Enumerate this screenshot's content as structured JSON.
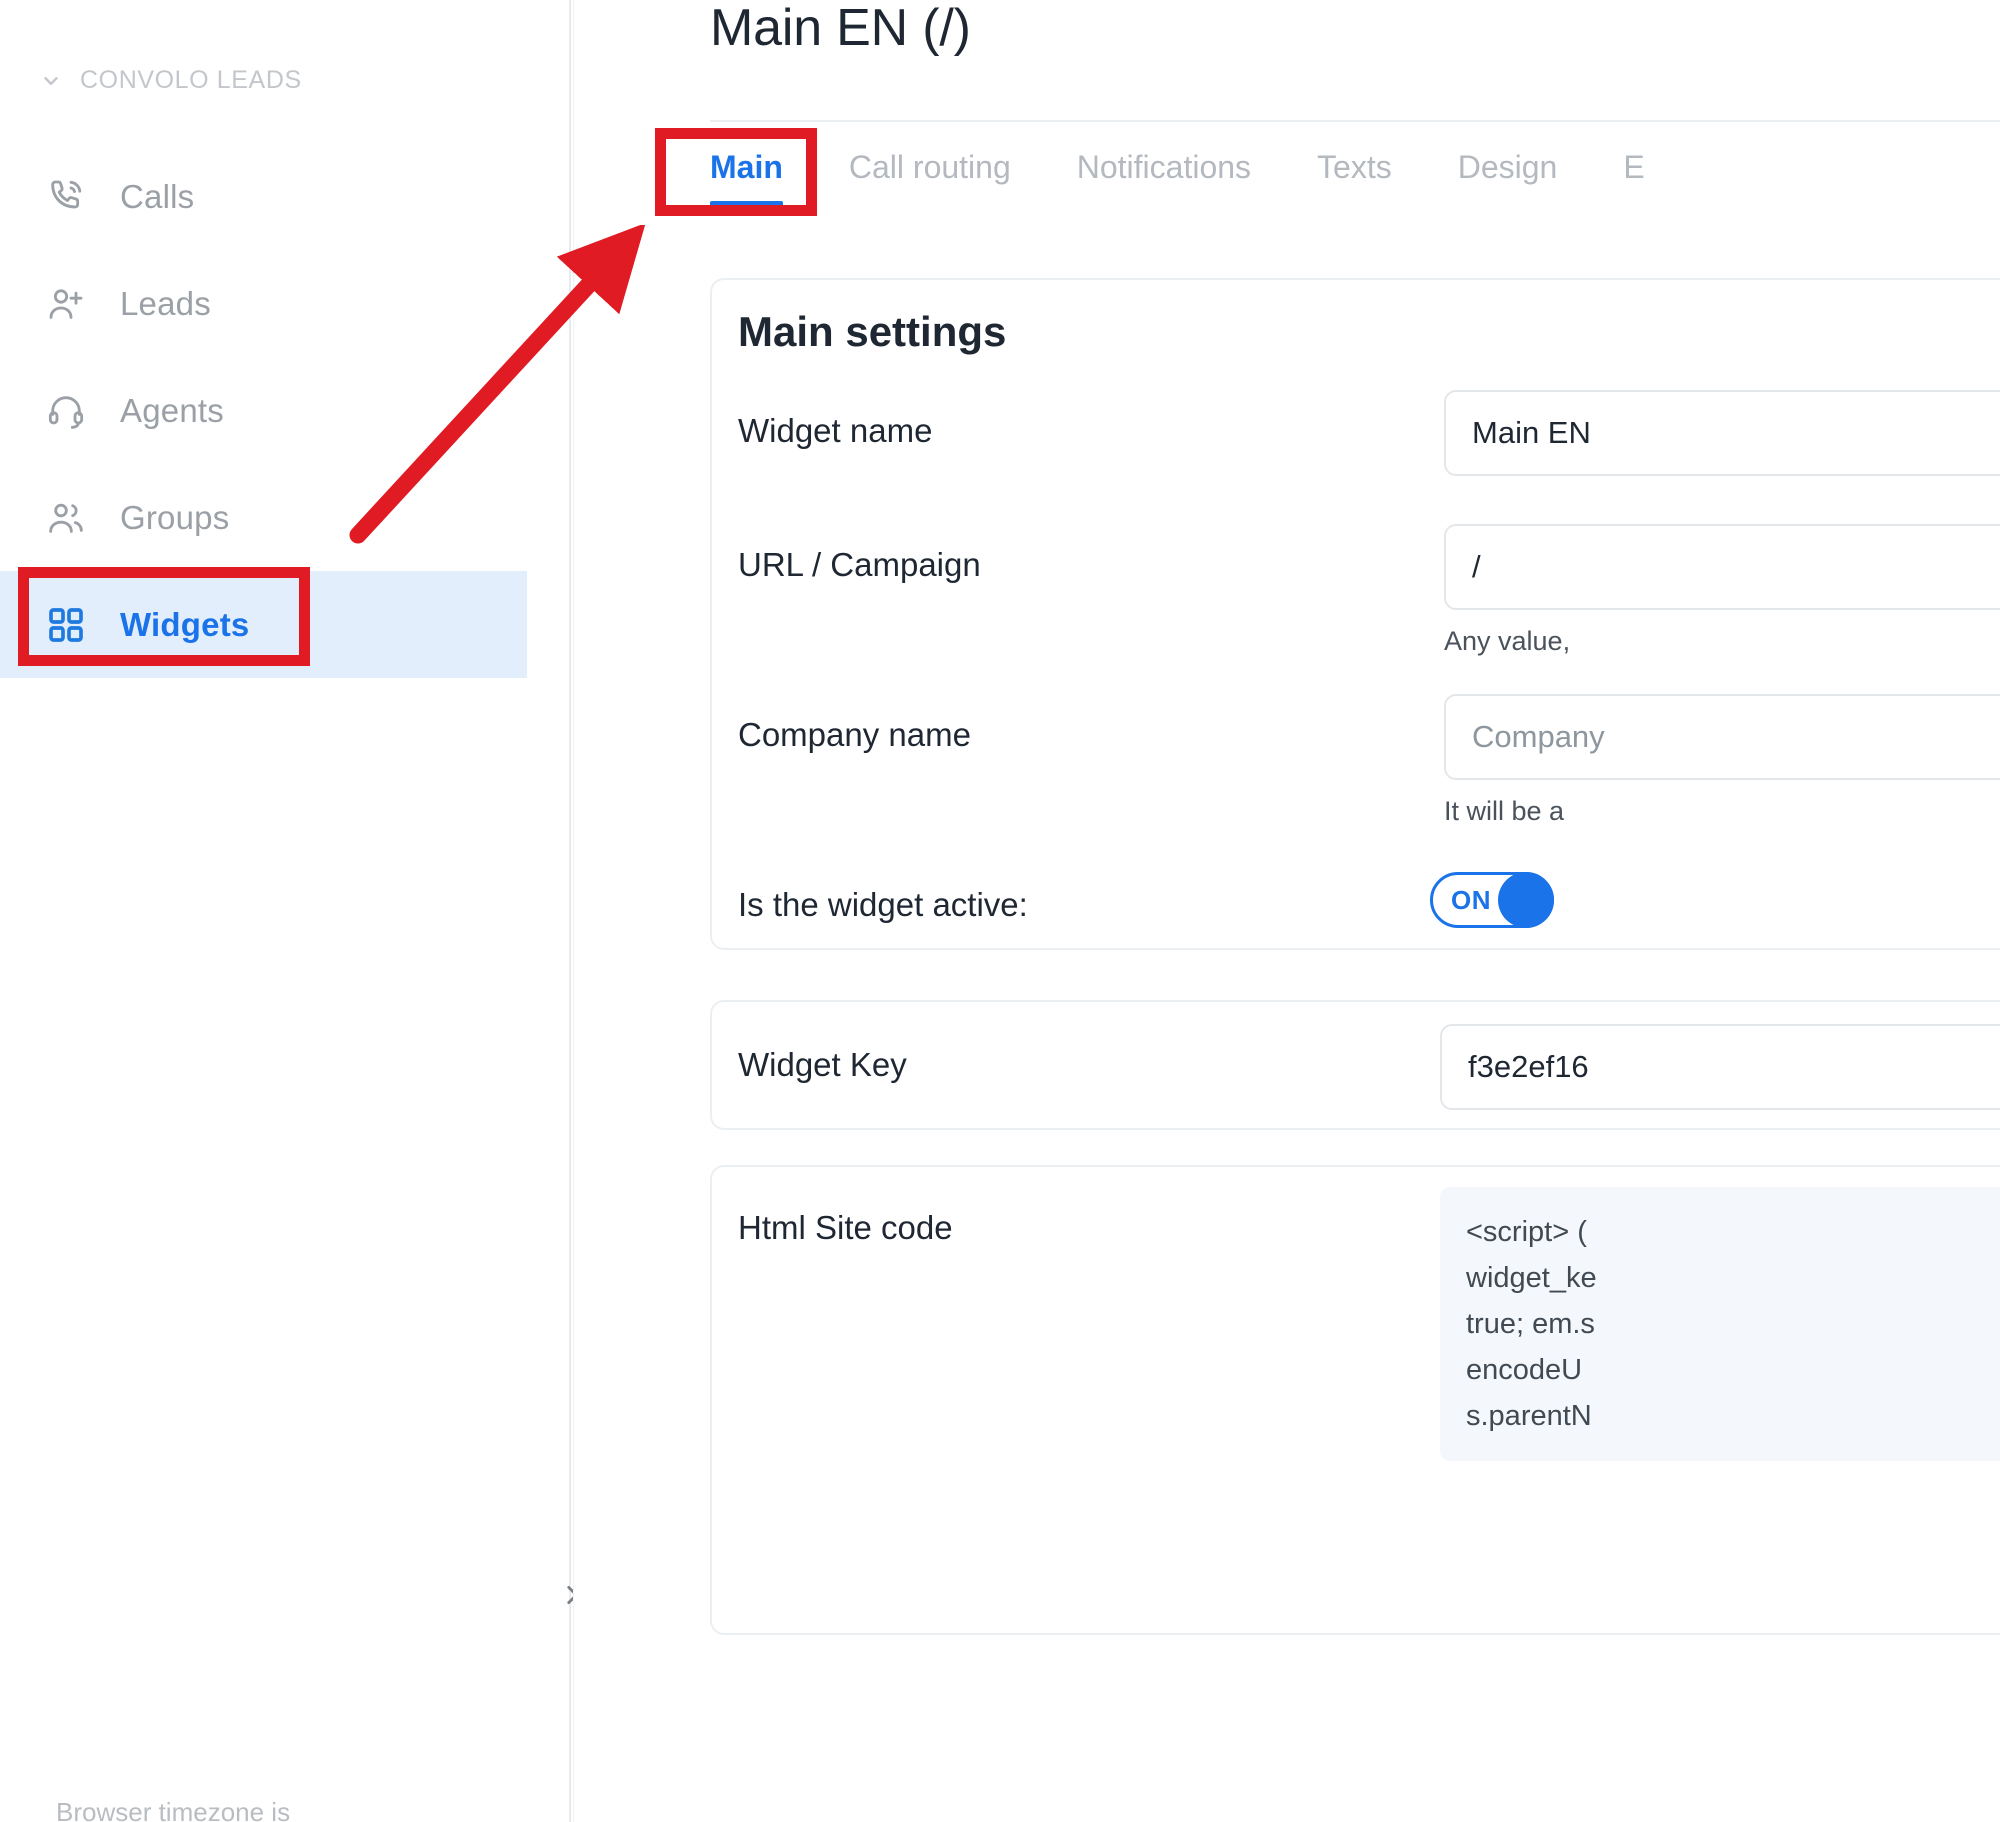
{
  "sidebar": {
    "section_label": "CONVOLO LEADS",
    "section_icon": "chevron-down-icon",
    "items": [
      {
        "label": "Calls",
        "icon": "phone-icon",
        "active": false
      },
      {
        "label": "Leads",
        "icon": "person-add-icon",
        "active": false
      },
      {
        "label": "Agents",
        "icon": "headset-icon",
        "active": false
      },
      {
        "label": "Groups",
        "icon": "people-icon",
        "active": false
      },
      {
        "label": "Widgets",
        "icon": "grid-squares-icon",
        "active": true
      }
    ],
    "footer_text": "Browser timezone is",
    "collapse_icon": "chevron-right-icon"
  },
  "header": {
    "title": "Main EN (/)"
  },
  "tabs": [
    {
      "label": "Main",
      "active": true
    },
    {
      "label": "Call routing",
      "active": false
    },
    {
      "label": "Notifications",
      "active": false
    },
    {
      "label": "Texts",
      "active": false
    },
    {
      "label": "Design",
      "active": false
    },
    {
      "label": "E",
      "active": false
    }
  ],
  "main_settings": {
    "title": "Main settings",
    "widget_name": {
      "label": "Widget name",
      "value": "Main  EN"
    },
    "url_campaign": {
      "label": "URL / Campaign",
      "value": "/",
      "hint": "Any value,"
    },
    "company_name": {
      "label": "Company name",
      "placeholder": "Company",
      "hint": "It will be a"
    },
    "widget_active": {
      "label": "Is the widget active:",
      "toggle_state": "ON"
    }
  },
  "widget_key": {
    "label": "Widget Key",
    "value": "f3e2ef16"
  },
  "html_site_code": {
    "label": "Html Site code",
    "code": "<script> (\nwidget_ke\ntrue; em.s\nencodeU\ns.parentN"
  },
  "colors": {
    "accent_blue": "#1a73e8",
    "active_row_bg": "#e3eefc",
    "annotation_red": "#e01b24",
    "muted_text": "#9aa0a6"
  }
}
